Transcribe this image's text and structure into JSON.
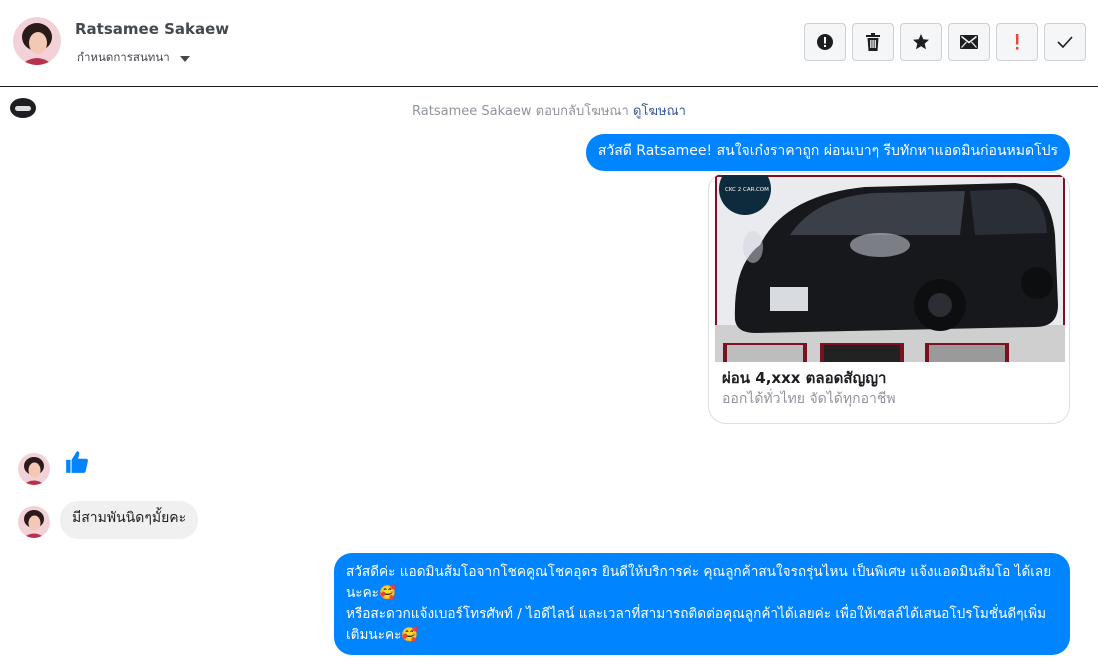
{
  "header": {
    "contact_name": "Ratsamee Sakaew",
    "assign_label": "กำหนดการสนทนา"
  },
  "toolbar": {
    "buttons": [
      {
        "name": "spam-alert",
        "icon": "alert-circle-icon"
      },
      {
        "name": "delete",
        "icon": "trash-icon"
      },
      {
        "name": "star",
        "icon": "star-icon"
      },
      {
        "name": "mark-unread",
        "icon": "envelope-icon"
      },
      {
        "name": "follow-up",
        "icon": "exclamation-icon",
        "color": "#fa3e3e"
      },
      {
        "name": "done",
        "icon": "checkmark-icon"
      }
    ]
  },
  "conversation": {
    "notice_prefix": "Ratsamee Sakaew ตอบกลับโฆษณา",
    "notice_link": "ดูโฆษณา",
    "ad_message": "สวัสดี Ratsamee! สนใจเก๋งราคาถูก ผ่อนเบาๆ รีบทักหาแอดมินก่อนหมดโปร",
    "ad_card": {
      "watermark": "CKC 2 CAR.COM",
      "title": "ผ่อน 4,xxx ตลอดสัญญา",
      "subtitle": "ออกได้ทั่วไทย จัดได้ทุกอาชีพ"
    },
    "customer_reply": "มีสามพันนิดๆมั้ยคะ",
    "admin_reply_lines": [
      "สวัสดีค่ะ แอดมินส้มโอจากโชคคูณโชคอุดร ยินดีให้บริการค่ะ   คุณลูกค้าสนใจรถรุ่นไหน เป็นพิเศษ แจ้งแอดมินส้มโอ ได้เลยนะคะ🥰",
      "หรือสะดวกแจ้งเบอร์โทรศัพท์ / ไอดีไลน์ และเวลาที่สามารถติดต่อคุณลูกค้าได้เลยค่ะ เพื่อให้เซลล์ได้เสนอโปรโมชั่นดีๆเพิ่มเติมนะคะ🥰"
    ]
  },
  "colors": {
    "outgoing_bubble": "#0084ff",
    "incoming_bubble": "#f1f0f0",
    "like_icon": "#0084ff"
  }
}
